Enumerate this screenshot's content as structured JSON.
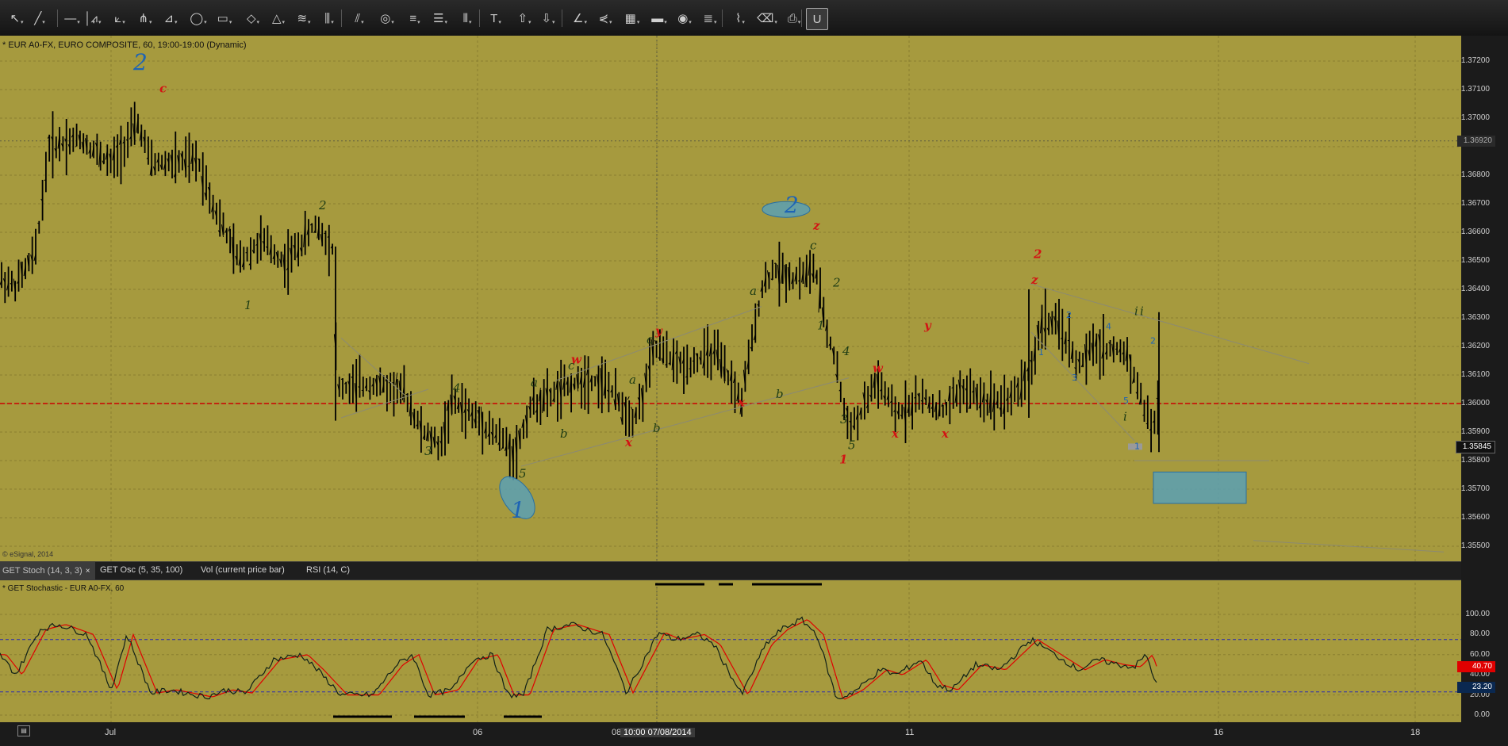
{
  "toolbar": {
    "tools": [
      {
        "icon": "cursor-arrow-icon",
        "glyph": "↖"
      },
      {
        "icon": "line-tool-icon",
        "glyph": "╱"
      },
      {
        "icon": "horizontal-line-icon",
        "glyph": "—"
      },
      {
        "icon": "vertical-line-icon",
        "glyph": "│"
      },
      {
        "icon": "zigzag-icon",
        "glyph": "⩘"
      },
      {
        "icon": "fan-icon",
        "glyph": "⟀"
      },
      {
        "icon": "pitchfork-icon",
        "glyph": "⋔"
      },
      {
        "icon": "gann-fan-icon",
        "glyph": "⊿"
      },
      {
        "icon": "ellipse-icon",
        "glyph": "◯"
      },
      {
        "icon": "rectangle-icon",
        "glyph": "▭"
      },
      {
        "icon": "eraser-icon",
        "glyph": "◇"
      },
      {
        "icon": "triangle-icon",
        "glyph": "△"
      },
      {
        "icon": "fibonacci-fan-icon",
        "glyph": "≋"
      },
      {
        "icon": "fibonacci-time-icon",
        "glyph": "⫼"
      },
      {
        "icon": "parallel-channel-icon",
        "glyph": "⫽"
      },
      {
        "icon": "circles-icon",
        "glyph": "◎"
      },
      {
        "icon": "fibonacci-retracement-icon",
        "glyph": "≡"
      },
      {
        "icon": "fibonacci-extension-icon",
        "glyph": "☰"
      },
      {
        "icon": "time-cycles-icon",
        "glyph": "⦀"
      },
      {
        "icon": "text-tool-icon",
        "glyph": "T"
      },
      {
        "icon": "arrow-up-icon",
        "glyph": "⇧"
      },
      {
        "icon": "arrow-down-icon",
        "glyph": "⇩"
      },
      {
        "icon": "angle-tool-icon",
        "glyph": "∠"
      },
      {
        "icon": "andrews-icon",
        "glyph": "⋞"
      },
      {
        "icon": "grid-icon",
        "glyph": "▦"
      },
      {
        "icon": "mob-icon",
        "glyph": "▬"
      },
      {
        "icon": "eye-icon",
        "glyph": "◉"
      },
      {
        "icon": "pti-icon",
        "glyph": "≣"
      },
      {
        "icon": "wave-count-icon",
        "glyph": "⌇"
      },
      {
        "icon": "erase-all-icon",
        "glyph": "⌫"
      },
      {
        "icon": "snapshot-icon",
        "glyph": "⎙"
      },
      {
        "icon": "magnet-icon",
        "glyph": "U"
      }
    ],
    "mob_label": "MOB",
    "pti_label": "PTI"
  },
  "chart": {
    "title": "* EUR A0-FX, EURO COMPOSITE, 60, 19:00-19:00 (Dynamic)",
    "watermark": "© eSignal, 2014",
    "price_labels": [
      "1.37200",
      "1.37100",
      "1.37000",
      "1.36800",
      "1.36700",
      "1.36600",
      "1.36500",
      "1.36400",
      "1.36300",
      "1.36200",
      "1.36100",
      "1.36000",
      "1.35900",
      "1.35800",
      "1.35700",
      "1.35600",
      "1.35500"
    ],
    "price_box_last": "1.35845",
    "price_box_cross": "1.36920",
    "horizontal_line_price": "1.36000",
    "colors": {
      "background": "#a69a3e",
      "bars": "#000000",
      "red_dashed": "#cc0000",
      "wave_red": "#d21414",
      "wave_green": "#1e3c14",
      "wave_blue": "#1e64b4"
    }
  },
  "tabs": {
    "stoch": "GET Stoch (14, 3, 3)",
    "stoch_close": "×",
    "osc": "GET Osc (5, 35, 100)",
    "vol": "Vol (current price bar)",
    "rsi": "RSI (14, C)"
  },
  "oscillator": {
    "title": "* GET Stochastic - EUR A0-FX, 60",
    "levels": [
      "100.00",
      "80.00",
      "60.00",
      "40.00",
      "20.00",
      "0.00"
    ],
    "box_red": "40.70",
    "box_blue": "23.20"
  },
  "dates": {
    "jul": "Jul",
    "d06": "06",
    "d08": "08",
    "crosshair": "10:00 07/08/2014",
    "d11": "11",
    "d16": "16",
    "d18": "18"
  },
  "wave_labels": [
    {
      "t": "2",
      "c": "blue",
      "big": true
    },
    {
      "t": "c",
      "c": "red"
    },
    {
      "t": "2",
      "c": "green"
    },
    {
      "t": "1",
      "c": "green"
    },
    {
      "t": "3",
      "c": "green"
    },
    {
      "t": "4",
      "c": "green"
    },
    {
      "t": "5",
      "c": "green"
    },
    {
      "t": "1",
      "c": "blue",
      "big": true
    },
    {
      "t": "a",
      "c": "green"
    },
    {
      "t": "b",
      "c": "green"
    },
    {
      "t": "c",
      "c": "green"
    },
    {
      "t": "w",
      "c": "red"
    },
    {
      "t": "a",
      "c": "green"
    },
    {
      "t": "b",
      "c": "green"
    },
    {
      "t": "x",
      "c": "red"
    },
    {
      "t": "c",
      "c": "green"
    },
    {
      "t": "y",
      "c": "red"
    },
    {
      "t": "x",
      "c": "red"
    },
    {
      "t": "a",
      "c": "green"
    },
    {
      "t": "b",
      "c": "green"
    },
    {
      "t": "c",
      "c": "green"
    },
    {
      "t": "z",
      "c": "red"
    },
    {
      "t": "2",
      "c": "blue",
      "big": true
    },
    {
      "t": "1",
      "c": "green"
    },
    {
      "t": "2",
      "c": "green"
    },
    {
      "t": "4",
      "c": "green"
    },
    {
      "t": "3",
      "c": "green"
    },
    {
      "t": "5",
      "c": "green"
    },
    {
      "t": "1",
      "c": "red"
    },
    {
      "t": "w",
      "c": "red"
    },
    {
      "t": "x",
      "c": "red"
    },
    {
      "t": "y",
      "c": "red"
    },
    {
      "t": "x",
      "c": "red"
    },
    {
      "t": "2",
      "c": "red"
    },
    {
      "t": "z",
      "c": "red"
    },
    {
      "t": "i",
      "c": "green"
    },
    {
      "t": "i",
      "c": "green"
    },
    {
      "t": "i",
      "c": "green"
    }
  ]
}
